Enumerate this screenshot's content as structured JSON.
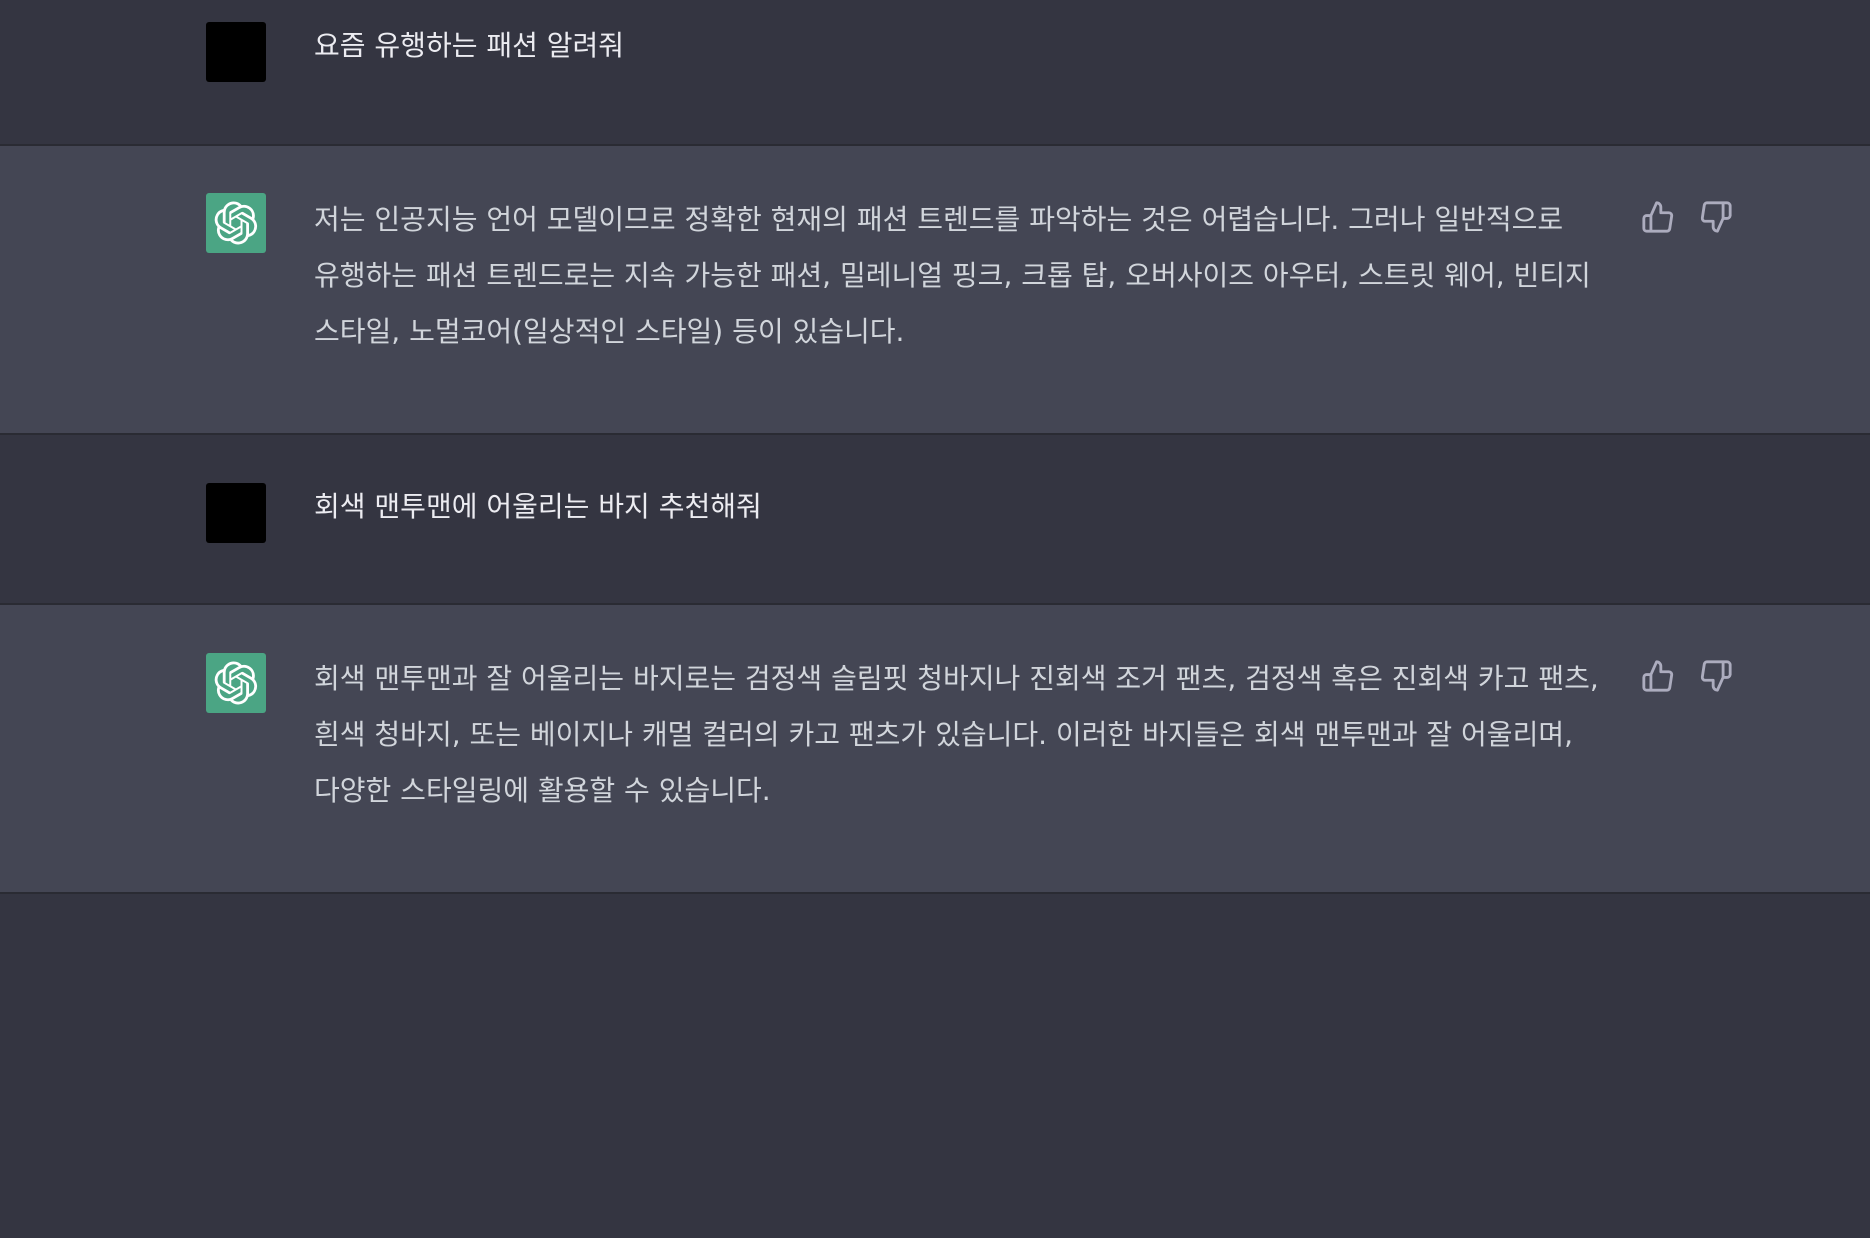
{
  "colors": {
    "page_background": "#343541",
    "assistant_row_background": "#444654",
    "user_avatar": "#000000",
    "assistant_avatar": "#4ba584",
    "text": "#d1d5db",
    "icon": "#acacbe"
  },
  "conversation": [
    {
      "role": "user",
      "avatar_icon": "user-avatar",
      "text": "요즘 유행하는 패션 알려줘"
    },
    {
      "role": "assistant",
      "avatar_icon": "openai-logo-icon",
      "text": "저는 인공지능 언어 모델이므로 정확한 현재의 패션 트렌드를 파악하는 것은 어렵습니다. 그러나 일반적으로 유행하는 패션 트렌드로는 지속 가능한 패션, 밀레니얼 핑크, 크롭 탑, 오버사이즈 아우터, 스트릿 웨어, 빈티지 스타일, 노멀코어(일상적인 스타일) 등이 있습니다.",
      "feedback_icons": [
        "thumbs-up-icon",
        "thumbs-down-icon"
      ]
    },
    {
      "role": "user",
      "avatar_icon": "user-avatar",
      "text": "회색 맨투맨에 어울리는 바지 추천해줘"
    },
    {
      "role": "assistant",
      "avatar_icon": "openai-logo-icon",
      "text": "회색 맨투맨과 잘 어울리는 바지로는 검정색 슬림핏 청바지나 진회색 조거 팬츠, 검정색 혹은 진회색 카고 팬츠, 흰색 청바지, 또는 베이지나 캐멀 컬러의 카고 팬츠가 있습니다. 이러한 바지들은 회색 맨투맨과 잘 어울리며, 다양한 스타일링에 활용할 수 있습니다.",
      "feedback_icons": [
        "thumbs-up-icon",
        "thumbs-down-icon"
      ]
    }
  ]
}
